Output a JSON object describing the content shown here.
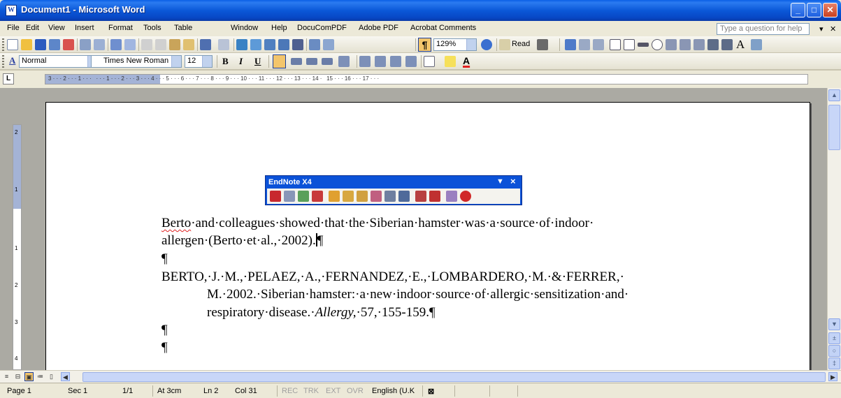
{
  "window": {
    "title": "Document1 - Microsoft Word",
    "app_icon": "W"
  },
  "menu": [
    "File",
    "Edit",
    "View",
    "Insert",
    "Format",
    "Tools",
    "Table",
    "Window",
    "Help",
    "DocuComPDF",
    "Adobe PDF",
    "Acrobat Comments"
  ],
  "help_placeholder": "Type a question for help",
  "standard_toolbar": {
    "zoom": "129%",
    "read_label": "Read",
    "pilcrow": "¶"
  },
  "formatting_toolbar": {
    "style": "Normal",
    "font": "Times New Roman",
    "size": "12",
    "style_icon": "A",
    "bold": "B",
    "italic": "I",
    "underline": "U"
  },
  "ruler": {
    "horizontal_text": "3 · · · 2 · · · 1 · · ·   · · · 1 · · · 2 · · · 3 · · · 4 · · · 5 · · · 6 · · · 7 · · · 8 · · · 9 · · · 10 · · · 11 · · · 12 · · · 13 · · · 14 ·   15 · · · 16 · · · 17 · · ·",
    "corner": "L",
    "vertical": [
      "2",
      "1",
      "1",
      "2",
      "3",
      "4"
    ]
  },
  "endnote": {
    "title": "EndNote X4",
    "dropdown": "▼",
    "close": "×"
  },
  "document": {
    "line1_word": "Berto",
    "line1_rest": "·and·colleagues·showed·that·the·Siberian·hamster·was·a·source·of·indoor·",
    "line2": "allergen·(Berto·et·al.,·2002).",
    "pilcrow": "¶",
    "ref_line1": "BERTO,·J.·M.,·PELAEZ,·A.,·FERNANDEZ,·E.,·LOMBARDERO,·M.·&·FERRER,·",
    "ref_line2": "M.·2002.·Siberian·hamster:·a·new·indoor·source·of·allergic·sensitization·and·",
    "ref_line3_a": "respiratory·disease.·",
    "ref_line3_journal": "Allergy,",
    "ref_line3_b": "·57,·155-159.¶"
  },
  "status": {
    "page": "Page 1",
    "sec": "Sec 1",
    "pages": "1/1",
    "at": "At 3cm",
    "ln": "Ln 2",
    "col": "Col 31",
    "rec": "REC",
    "trk": "TRK",
    "ext": "EXT",
    "ovr": "OVR",
    "language": "English (U.K"
  }
}
